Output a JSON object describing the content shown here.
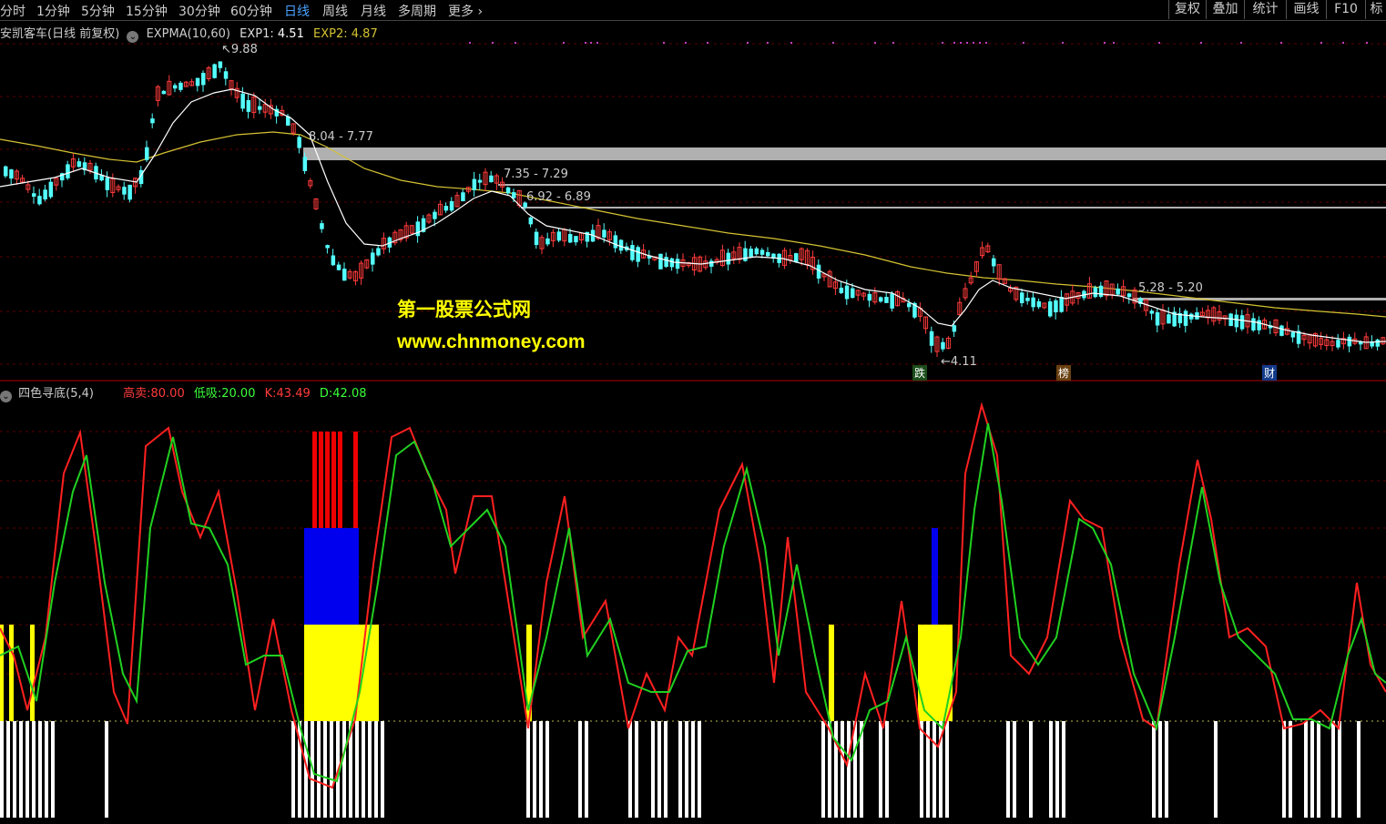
{
  "toolbar": {
    "periods": [
      "分时",
      "1分钟",
      "5分钟",
      "15分钟",
      "30分钟",
      "60分钟",
      "日线",
      "周线",
      "月线",
      "多周期",
      "更多"
    ],
    "active": "日线",
    "right_buttons": [
      "复权",
      "叠加",
      "统计",
      "画线",
      "F10",
      "标"
    ]
  },
  "price_panel": {
    "stock_title": "安凯客车(日线 前复权)",
    "indicator": "EXPMA(10,60)",
    "exp1_label": "EXP1:",
    "exp1_value": "4.51",
    "exp2_label": "EXP2:",
    "exp2_value": "4.87",
    "high_annotation": "9.88",
    "low_annotation": "4.11",
    "ranges": [
      "8.04 - 7.77",
      "7.35 - 7.29",
      "6.92 - 6.89",
      "5.28 - 5.20"
    ],
    "markers": [
      "跌",
      "榜",
      "财"
    ],
    "watermark_cn": "第一股票公式网",
    "watermark_url": "www.chnmoney.com"
  },
  "kd_panel": {
    "title": "四色寻底(5,4)",
    "gaomai_label": "高卖:",
    "gaomai_value": "80.00",
    "dixi_label": "低吸:",
    "dixi_value": "20.00",
    "k_label": "K:",
    "k_value": "43.49",
    "d_label": "D:",
    "d_value": "42.08"
  },
  "colors": {
    "up": "#ff3b3b",
    "down": "#54ffff",
    "exp1": "#ffffff",
    "exp2": "#d4c232",
    "k_line": "#ff2020",
    "d_line": "#20d020",
    "yellow": "#ffff00",
    "blue": "#0000ee",
    "red": "#ee0000",
    "white": "#ffffff"
  }
}
